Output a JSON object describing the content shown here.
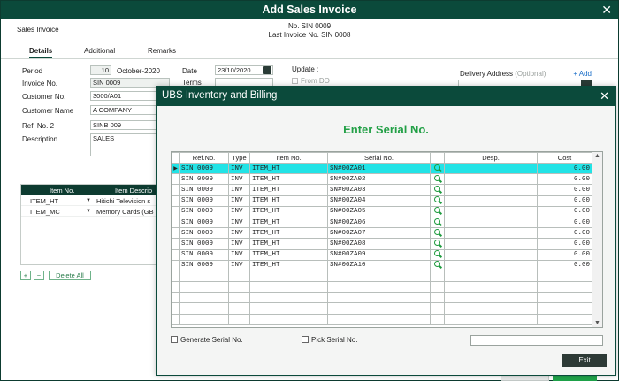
{
  "window": {
    "title": "Add Sales Invoice",
    "close": "✕"
  },
  "header": {
    "module": "Sales Invoice",
    "doc_no": "No. SIN 0009",
    "last_invoice": "Last Invoice No. SIN 0008"
  },
  "tabs": [
    "Details",
    "Additional",
    "Remarks"
  ],
  "form": {
    "period_label": "Period",
    "period_num": "10",
    "period_month": "October-2020",
    "date_label": "Date",
    "date_value": "23/10/2020",
    "terms_label": "Terms",
    "invoice_label": "Invoice No.",
    "invoice_value": "SIN 0009",
    "customer_no_label": "Customer No.",
    "customer_no_value": "3000/A01",
    "customer_name_label": "Customer Name",
    "customer_name_value": "A COMPANY",
    "ref2_label": "Ref. No. 2",
    "ref2_value": "SINB 009",
    "desc_label": "Description",
    "desc_value": "SALES",
    "update_label": "Update :",
    "from_do_label": "From DO",
    "delivery_label": "Delivery Address",
    "delivery_optional": "(Optional)",
    "add_link": "+ Add"
  },
  "items_grid": {
    "headers": [
      "Item No.",
      "Item Descrip"
    ],
    "rows": [
      {
        "item": "ITEM_HT",
        "desc": "Hitichi Television s"
      },
      {
        "item": "ITEM_MC",
        "desc": "Memory Cards  (GB"
      }
    ],
    "plus": "+",
    "minus": "−",
    "delete_all": "Delete All"
  },
  "modal": {
    "title": "UBS Inventory and Billing",
    "close": "✕",
    "heading": "Enter Serial No.",
    "columns": [
      "Ref.No.",
      "Type",
      "Item No.",
      "Serial No.",
      "",
      "Desp.",
      "Cost"
    ],
    "rows": [
      {
        "ref": "SIN 0009",
        "type": "INV",
        "item": "ITEM_HT",
        "serial": "SN#00ZA01",
        "desp": "",
        "cost": "0.00"
      },
      {
        "ref": "SIN 0009",
        "type": "INV",
        "item": "ITEM_HT",
        "serial": "SN#00ZA02",
        "desp": "",
        "cost": "0.00"
      },
      {
        "ref": "SIN 0009",
        "type": "INV",
        "item": "ITEM_HT",
        "serial": "SN#00ZA03",
        "desp": "",
        "cost": "0.00"
      },
      {
        "ref": "SIN 0009",
        "type": "INV",
        "item": "ITEM_HT",
        "serial": "SN#00ZA04",
        "desp": "",
        "cost": "0.00"
      },
      {
        "ref": "SIN 0009",
        "type": "INV",
        "item": "ITEM_HT",
        "serial": "SN#00ZA05",
        "desp": "",
        "cost": "0.00"
      },
      {
        "ref": "SIN 0009",
        "type": "INV",
        "item": "ITEM_HT",
        "serial": "SN#00ZA06",
        "desp": "",
        "cost": "0.00"
      },
      {
        "ref": "SIN 0009",
        "type": "INV",
        "item": "ITEM_HT",
        "serial": "SN#00ZA07",
        "desp": "",
        "cost": "0.00"
      },
      {
        "ref": "SIN 0009",
        "type": "INV",
        "item": "ITEM_HT",
        "serial": "SN#00ZA08",
        "desp": "",
        "cost": "0.00"
      },
      {
        "ref": "SIN 0009",
        "type": "INV",
        "item": "ITEM_HT",
        "serial": "SN#00ZA09",
        "desp": "",
        "cost": "0.00"
      },
      {
        "ref": "SIN 0009",
        "type": "INV",
        "item": "ITEM_HT",
        "serial": "SN#00ZA10",
        "desp": "",
        "cost": "0.00"
      }
    ],
    "empty_rows": 5,
    "selected_row": 0,
    "generate_serial": "Generate Serial No.",
    "pick_serial": "Pick Serial No.",
    "exit": "Exit"
  },
  "colors": {
    "title_bar": "#0b4a3b",
    "selection": "#22e3e6",
    "accent_green": "#22a046"
  },
  "icons": [
    "close-icon",
    "calendar-icon",
    "search-icon",
    "row-pointer-icon",
    "dropdown-icon"
  ]
}
